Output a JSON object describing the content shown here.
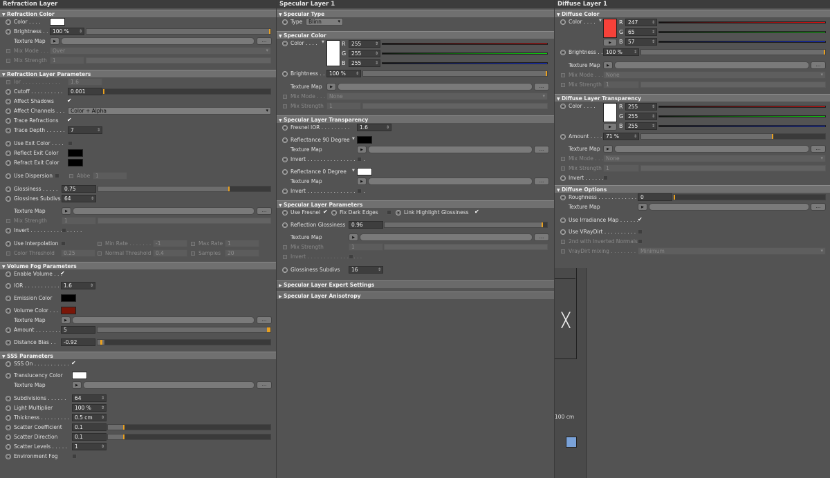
{
  "panelA": {
    "title": "Refraction Layer",
    "refractionColor": {
      "section": "Refraction Color",
      "color": "Color",
      "brightness": "Brightness",
      "brightnessVal": "100 %",
      "textureMap": "Texture Map",
      "mixMode": "Mix Mode",
      "mixModeVal": "Over",
      "mixStrength": "Mix Strength",
      "mixStrengthVal": "1",
      "dots": "..."
    },
    "params": {
      "section": "Refraction Layer Parameters",
      "ior": "Ior",
      "iorVal": "1.6",
      "cutoff": "Cutoff",
      "cutoffVal": "0.001",
      "affectShadows": "Affect Shadows",
      "affectChannels": "Affect Channels",
      "affectChannelsVal": "Color + Alpha",
      "traceRefractions": "Trace Refractions",
      "traceDepth": "Trace Depth",
      "traceDepthVal": "7",
      "useExitColor": "Use Exit Color",
      "reflectExit": "Reflect Exit Color",
      "refractExit": "Refract Exit Color",
      "useDispersion": "Use Dispersion",
      "abbe": "Abbe",
      "abbeVal": "1",
      "glossiness": "Glossiness",
      "glossinessVal": "0.75",
      "glossSubdivs": "Glossines Subdivs",
      "glossSubdivsVal": "64",
      "textureMap": "Texture Map",
      "mixStrength": "Mix Strength",
      "mixStrengthVal": "1",
      "invert": "Invert",
      "useInterp": "Use Interpolation",
      "minRate": "Min Rate",
      "minRateVal": "-1",
      "maxRate": "Max Rate",
      "maxRateVal": "1",
      "colorThreshold": "Color Threshold",
      "colorThresholdVal": "0.25",
      "normalThreshold": "Normal Threshold",
      "normalThresholdVal": "0.4",
      "samples": "Samples",
      "samplesVal": "20"
    },
    "fog": {
      "section": "Volume Fog Parameters",
      "enable": "Enable Volume",
      "ior": "IOR",
      "iorVal": "1.6",
      "emission": "Emission Color",
      "volColor": "Volume Color",
      "textureMap": "Texture Map",
      "amount": "Amount",
      "amountVal": "5",
      "distBias": "Distance Bias",
      "distBiasVal": "-0.92"
    },
    "sss": {
      "section": "SSS Parameters",
      "on": "SSS On",
      "transColor": "Translucency Color",
      "textureMap": "Texture Map",
      "subdivs": "Subdivisions",
      "subdivsVal": "64",
      "lightMult": "Light Multiplier",
      "lightMultVal": "100 %",
      "thickness": "Thickness",
      "thicknessVal": "0.5 cm",
      "scatterCoef": "Scatter Coefficient",
      "scatterCoefVal": "0.1",
      "scatterDir": "Scatter Direction",
      "scatterDirVal": "0.1",
      "scatterLevels": "Scatter Levels",
      "scatterLevelsVal": "1",
      "envFog": "Environment Fog"
    }
  },
  "panelB": {
    "title": "Specular Layer 1",
    "type": {
      "section": "Specular Type",
      "label": "Type",
      "value": "Blinn"
    },
    "color": {
      "section": "Specular Color",
      "color": "Color",
      "r": "255",
      "g": "255",
      "b": "255",
      "R": "R",
      "G": "G",
      "B": "B",
      "brightness": "Brightness",
      "brightnessVal": "100 %",
      "textureMap": "Texture Map",
      "mixMode": "Mix Mode",
      "mixModeVal": "None",
      "mixStrength": "Mix Strength",
      "mixStrengthVal": "1"
    },
    "trans": {
      "section": "Specular Layer Transparency",
      "fresnelIor": "Fresnel IOR",
      "fresnelIorVal": "1.6",
      "refl90": "Reflectance 90 Degree",
      "textureMap": "Texture Map",
      "invert": "Invert",
      "refl0": "Reflectance  0 Degree"
    },
    "params": {
      "section": "Specular Layer Parameters",
      "useFresnel": "Use Fresnel",
      "fixDark": "Fix Dark Edges",
      "linkHighlight": "Link Highlight Glossiness",
      "reflGloss": "Reflection Glossiness",
      "reflGlossVal": "0.96",
      "textureMap": "Texture Map",
      "mixStrength": "Mix Strength",
      "mixStrengthVal": "1",
      "invert": "Invert",
      "glossSubdivs": "Glossiness Subdivs",
      "glossSubdivsVal": "16"
    },
    "expert": "Specular Layer Expert Settings",
    "aniso": "Specular Layer Anisotropy"
  },
  "panelC": {
    "title": "Diffuse Layer 1",
    "color": {
      "section": "Diffuse Color",
      "color": "Color",
      "r": "247",
      "g": "65",
      "b": "57",
      "R": "R",
      "G": "G",
      "B": "B",
      "brightness": "Brightness",
      "brightnessVal": "100 %",
      "textureMap": "Texture Map",
      "mixMode": "Mix Mode",
      "mixModeVal": "None",
      "mixStrength": "Mix Strength",
      "mixStrengthVal": "1"
    },
    "trans": {
      "section": "Diffuse Layer Transparency",
      "color": "Color",
      "r": "255",
      "g": "255",
      "b": "255",
      "R": "R",
      "G": "G",
      "B": "B",
      "amount": "Amount",
      "amountVal": "71 %",
      "textureMap": "Texture Map",
      "mixMode": "Mix Mode",
      "mixModeVal": "None",
      "mixStrength": "Mix Strength",
      "mixStrengthVal": "1",
      "invert": "Invert"
    },
    "options": {
      "section": "Diffuse Options",
      "roughness": "Roughness",
      "roughnessVal": "0",
      "textureMap": "Texture Map",
      "irradiance": "Use Irradiance Map",
      "vraydirt": "Use VRayDirt",
      "inverted": "2nd with Inverted Normals",
      "mixing": "VrayDirt mixing",
      "mixingVal": "Minimum"
    },
    "viewport": {
      "size": "100 cm"
    }
  }
}
